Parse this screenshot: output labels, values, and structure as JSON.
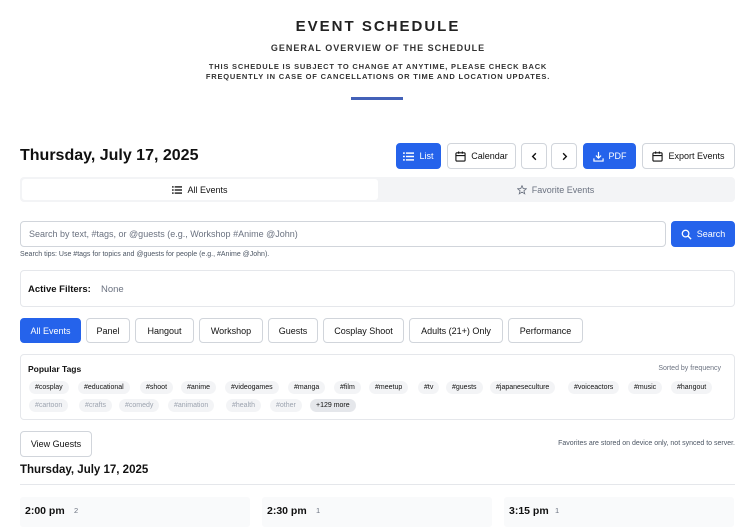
{
  "header": {
    "title": "EVENT SCHEDULE",
    "subtitle": "GENERAL OVERVIEW OF THE SCHEDULE",
    "note": "THIS SCHEDULE IS SUBJECT TO CHANGE AT ANYTIME, PLEASE CHECK BACK FREQUENTLY IN CASE OF CANCELLATIONS OR TIME AND LOCATION UPDATES."
  },
  "toolbar": {
    "date_heading": "Thursday, July 17, 2025",
    "list_label": "List",
    "calendar_label": "Calendar",
    "pdf_label": "PDF",
    "export_label": "Export Events"
  },
  "tabs": {
    "all_events": "All Events",
    "favorite_events": "Favorite Events"
  },
  "search": {
    "placeholder": "Search by text, #tags, or @guests (e.g., Workshop #Anime @John)",
    "value": "",
    "button_label": "Search",
    "tips": "Search tips: Use #tags for topics and @guests for people (e.g., #Anime @John)."
  },
  "filters": {
    "label": "Active Filters:",
    "value": "None"
  },
  "categories": [
    "All Events",
    "Panel",
    "Hangout",
    "Workshop",
    "Guests",
    "Cosplay Shoot",
    "Adults (21+) Only",
    "Performance"
  ],
  "active_category": "All Events",
  "popular_tags": {
    "title": "Popular Tags",
    "sort_note": "Sorted by frequency",
    "row1": [
      "#cosplay",
      "#educational",
      "#shoot",
      "#anime",
      "#videogames",
      "#manga",
      "#film",
      "#meetup",
      "#tv",
      "#guests",
      "#japaneseculture",
      "#voiceactors",
      "#music",
      "#hangout"
    ],
    "row2": [
      "#cartoon",
      "#crafts",
      "#comedy",
      "#animation",
      "#health",
      "#other"
    ],
    "more_label": "+129 more"
  },
  "view_guests_label": "View Guests",
  "favorites_note": "Favorites are stored on device only, not synced to server.",
  "list_date": "Thursday, July 17, 2025",
  "time_slots": [
    {
      "time": "2:00 pm",
      "count": "2"
    },
    {
      "time": "2:30 pm",
      "count": "1"
    },
    {
      "time": "3:15 pm",
      "count": "1"
    }
  ],
  "colors": {
    "primary": "#2563eb",
    "accent_bar": "#4361b8",
    "border": "#d1d5db",
    "muted_text": "#6b7280"
  }
}
